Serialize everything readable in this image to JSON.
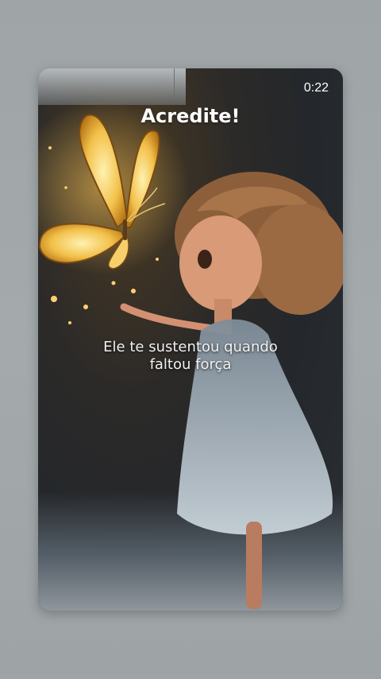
{
  "video": {
    "timer": "0:22",
    "title": "Acredite!",
    "caption_line1": "Ele te sustentou quando",
    "caption_line2": "faltou força"
  },
  "colors": {
    "background": "#a2a8aa",
    "butterfly": "#f2c04a",
    "dress": "#a9b8c4",
    "hair": "#9b6a42"
  },
  "icons": [
    "butterfly-illustration",
    "girl-illustration"
  ]
}
